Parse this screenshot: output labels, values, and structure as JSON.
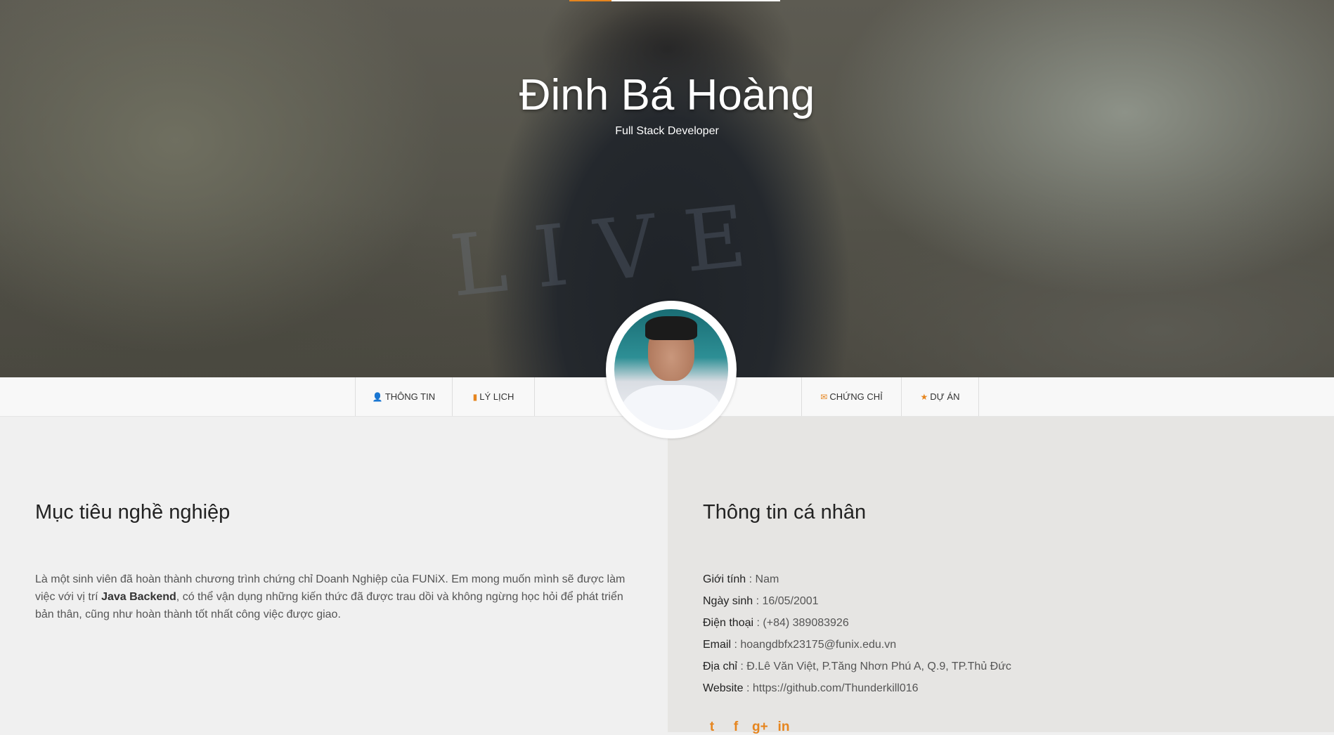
{
  "hero": {
    "name": "Đinh Bá Hoàng",
    "title": "Full Stack Developer",
    "shirt_text": "LIVE"
  },
  "nav": {
    "items": [
      {
        "label": "THÔNG TIN",
        "icon": "user-icon"
      },
      {
        "label": "LÝ LỊCH",
        "icon": "file-icon"
      },
      {
        "label": "CHỨNG CHỈ",
        "icon": "envelope-icon"
      },
      {
        "label": "DỰ ÁN",
        "icon": "star-icon"
      }
    ]
  },
  "objective": {
    "heading": "Mục tiêu nghề nghiệp",
    "text_before": "Là một sinh viên đã hoàn thành chương trình chứng chỉ Doanh Nghiệp của FUNiX. Em mong muốn mình sẽ được làm việc với vị trí ",
    "text_bold": "Java Backend",
    "text_after": ", có thể vận dụng những kiến thức đã được trau dồi và không ngừng học hỏi để phát triển bản thân, cũng như hoàn thành tốt nhất công việc được giao."
  },
  "personal": {
    "heading": "Thông tin cá nhân",
    "rows": [
      {
        "label": "Giới tính",
        "value": "Nam"
      },
      {
        "label": "Ngày sinh",
        "value": "16/05/2001"
      },
      {
        "label": "Điện thoại",
        "value": "(+84) 389083926"
      },
      {
        "label": "Email",
        "value": "hoangdbfx23175@funix.edu.vn"
      },
      {
        "label": "Địa chỉ",
        "value": "Đ.Lê Văn Việt, P.Tăng Nhơn Phú A, Q.9, TP.Thủ Đức"
      },
      {
        "label": "Website",
        "value": "https://github.com/Thunderkill016"
      }
    ],
    "separator": " : "
  },
  "socials": [
    {
      "name": "twitter-icon",
      "glyph": "t"
    },
    {
      "name": "facebook-icon",
      "glyph": "f"
    },
    {
      "name": "google-plus-icon",
      "glyph": "g+"
    },
    {
      "name": "linkedin-icon",
      "glyph": "in"
    }
  ],
  "colors": {
    "accent": "#e6851e",
    "left_bg": "#f0f0f0",
    "right_bg": "#e6e5e3"
  },
  "icons": {
    "user": "👤",
    "file": "▮",
    "envelope": "✉",
    "star": "★"
  }
}
